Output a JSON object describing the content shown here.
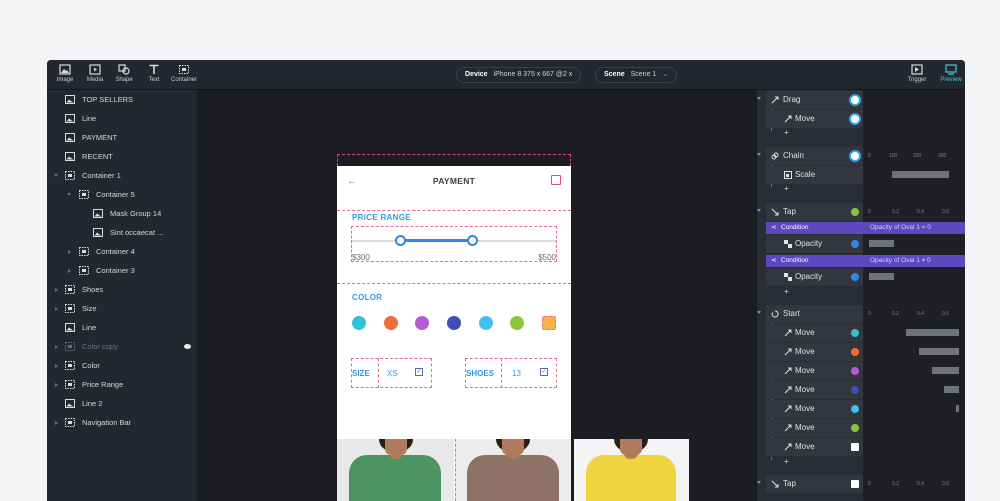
{
  "toolbar": {
    "tools": [
      "Image",
      "Media",
      "Shape",
      "Text",
      "Container"
    ],
    "device_label": "Device",
    "device_value": "iPhone 8  375 x 667  @2 x",
    "scene_label": "Scene",
    "scene_value": "Scene 1",
    "right_tools": [
      "Trigger",
      "Preview"
    ]
  },
  "layers": [
    {
      "label": "TOP SELLERS",
      "icon": "image-icon"
    },
    {
      "label": "Line",
      "icon": "image-icon"
    },
    {
      "label": "PAYMENT",
      "icon": "image-icon"
    },
    {
      "label": "RECENT",
      "icon": "image-icon"
    },
    {
      "label": "Container 1",
      "icon": "container-icon"
    },
    {
      "label": "Container 5",
      "icon": "container-icon"
    },
    {
      "label": "Mask Group 14",
      "icon": "image-icon"
    },
    {
      "label": "Sint occaecat ...",
      "icon": "container-icon"
    },
    {
      "label": "Container 4",
      "icon": "container-icon"
    },
    {
      "label": "Container 3",
      "icon": "container-icon"
    },
    {
      "label": "Shoes",
      "icon": "container-icon"
    },
    {
      "label": "Size",
      "icon": "container-icon"
    },
    {
      "label": "Line",
      "icon": "image-icon"
    },
    {
      "label": "Color copy",
      "icon": "container-icon"
    },
    {
      "label": "Color",
      "icon": "container-icon"
    },
    {
      "label": "Price Range",
      "icon": "container-icon"
    },
    {
      "label": "Line 2",
      "icon": "image-icon"
    },
    {
      "label": "Navigation Bar",
      "icon": "container-icon"
    }
  ],
  "phone": {
    "title": "PAYMENT",
    "price_range_label": "PRICE RANGE",
    "price_min": "$300",
    "price_max": "$500",
    "color_label": "COLOR",
    "colors": [
      "#2fc2d6",
      "#f26b3a",
      "#b55bd4",
      "#3f4db8",
      "#3fc0ef",
      "#8bc540",
      "#f6b24b"
    ],
    "size_label": "SIZE",
    "size_value": "XS",
    "shoes_label": "SHOES",
    "shoes_value": "13"
  },
  "interactions": {
    "drag": "Drag",
    "move": "Move",
    "chain": "Chain",
    "scale": "Scale",
    "tap": "Tap",
    "condition": "Condition",
    "opacity": "Opacity",
    "cond1": "Opacity of Oval 1 = 0",
    "cond2": "Opacity of Oval 1 ≠ 0",
    "start": "Start",
    "plus": "+",
    "chain_ticks": [
      "0",
      "100",
      "200",
      "300"
    ],
    "time_ticks": [
      "0",
      "0.2",
      "0.4",
      "0.6"
    ],
    "move_colors": [
      "#2fc2d6",
      "#f26b3a",
      "#b55bd4",
      "#3f4db8",
      "#3fc0ef",
      "#8bc540",
      "#ffffff"
    ]
  }
}
